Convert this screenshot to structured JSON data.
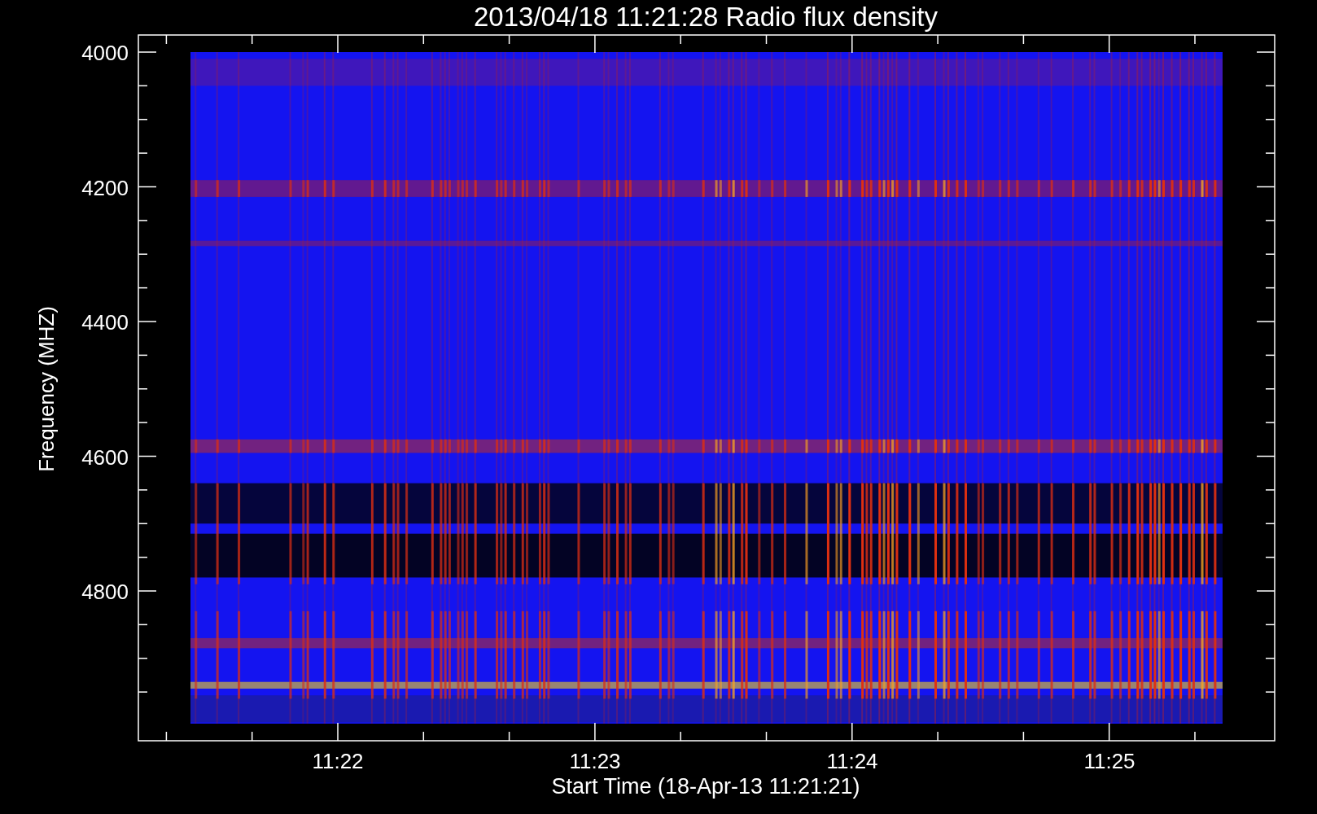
{
  "title": "2013/04/18 11:21:28 Radio flux density",
  "y_axis": {
    "label": "Frequency (MHZ)",
    "ticks": [
      "4000",
      "4200",
      "4400",
      "4600",
      "4800"
    ]
  },
  "x_axis": {
    "label": "Start Time (18-Apr-13 11:21:21)",
    "ticks": [
      "11:22",
      "11:23",
      "11:24",
      "11:25"
    ]
  }
}
